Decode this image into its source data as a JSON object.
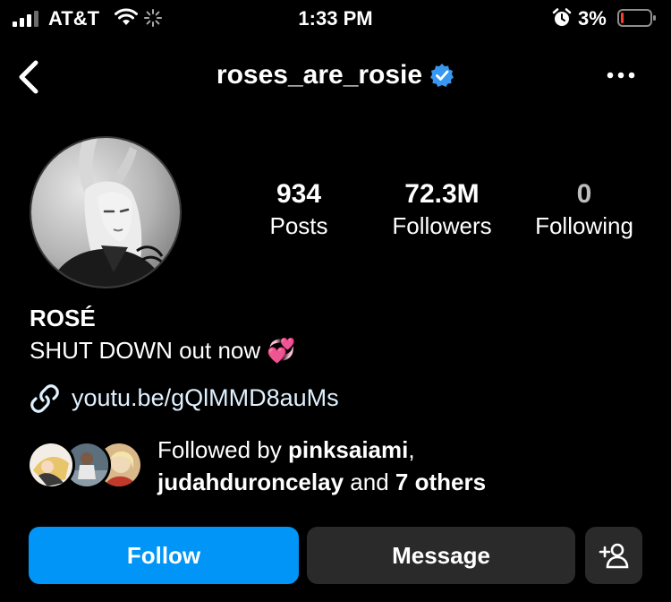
{
  "status_bar": {
    "carrier": "AT&T",
    "time": "1:33 PM",
    "battery": "3%",
    "icons": [
      "signal-icon",
      "wifi-icon",
      "loading-spinner-icon",
      "alarm-icon",
      "battery-icon"
    ]
  },
  "nav": {
    "username": "roses_are_rosie",
    "verified": true,
    "icons": [
      "back-icon",
      "verified-badge-icon",
      "more-icon"
    ]
  },
  "profile": {
    "stats": [
      {
        "value": "934",
        "label": "Posts"
      },
      {
        "value": "72.3M",
        "label": "Followers"
      },
      {
        "value": "0",
        "label": "Following"
      }
    ],
    "name": "ROSÉ",
    "bio": "SHUT DOWN out now 💞",
    "link": "youtu.be/gQlMMD8auMs",
    "followed_by": {
      "prefix": "Followed by",
      "first": "pinksaiami",
      "separator": ",",
      "second": "judahduroncelay",
      "and": "and",
      "others": "7 others"
    }
  },
  "actions": {
    "follow": "Follow",
    "message": "Message"
  },
  "colors": {
    "background": "#000000",
    "follow_button": "#0095f6",
    "secondary_button": "#2a2a2a",
    "verified_badge": "#3897f0",
    "battery_low": "#ff3b30"
  }
}
